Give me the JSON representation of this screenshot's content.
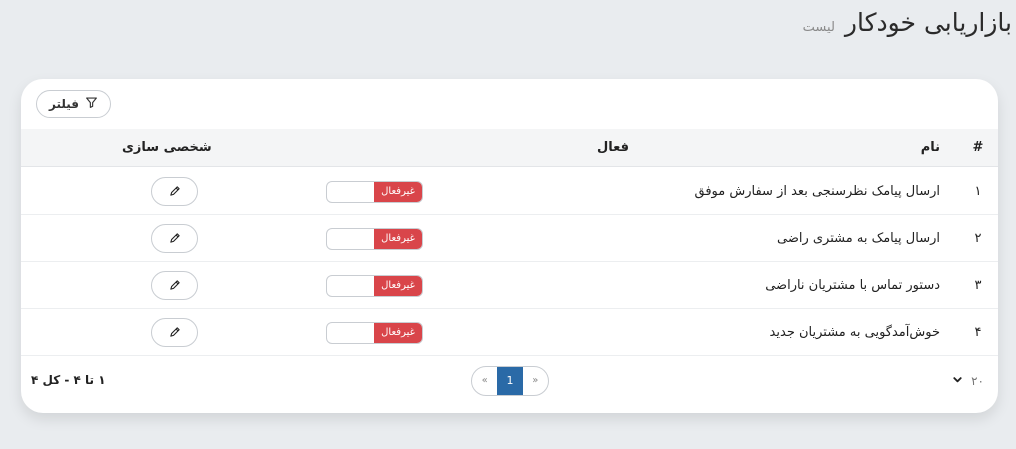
{
  "page": {
    "title": "بازاریابی خودکار",
    "subtitle": "لیست"
  },
  "toolbar": {
    "filter_label": "فیلتر",
    "filter_icon": "filter-icon"
  },
  "table": {
    "headers": {
      "index": "#",
      "name": "نام",
      "active": "فعال",
      "customize": "شخصی سازی"
    },
    "rows": [
      {
        "index": "۱",
        "name": "ارسال پیامک نظرسنجی بعد از سفارش موفق",
        "status": "غیرفعال"
      },
      {
        "index": "۲",
        "name": "ارسال پیامک به مشتری راضی",
        "status": "غیرفعال"
      },
      {
        "index": "۳",
        "name": "دستور تماس با مشتریان ناراضی",
        "status": "غیرفعال"
      },
      {
        "index": "۴",
        "name": "خوش‌آمدگویی به مشتریان جدید",
        "status": "غیرفعال"
      }
    ]
  },
  "footer": {
    "page_size": "۲۰",
    "pagination": {
      "prev": "«",
      "current": "1",
      "next": "»"
    },
    "record_info": "۱ تا ۴ - کل ۴"
  },
  "colors": {
    "inactive_badge": "#d9454a",
    "current_page": "#2a6aa7",
    "background": "#e9ecef"
  }
}
